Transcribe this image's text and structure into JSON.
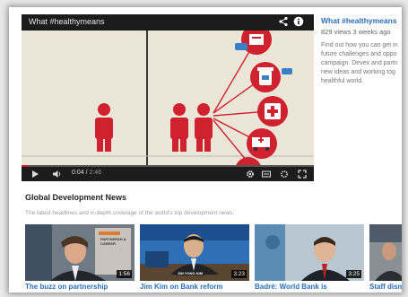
{
  "player": {
    "title": "What #healthymeans",
    "time_current": "0:04",
    "time_duration": "2:46",
    "progress": 0.024
  },
  "info": {
    "title": "What #healthymeans",
    "meta": "829 views  3 weeks ago",
    "desc_lines": [
      "Find out how you can get in",
      "future challenges and oppo",
      "campaign. Devex and partn",
      "new ideas and working tog",
      "healthful world."
    ]
  },
  "section": {
    "title": "Global Development News",
    "subtitle": "The latest headlines and in-depth coverage of the world's top development news."
  },
  "thumbs": [
    {
      "caption": "The buzz on partnership",
      "duration": "1:56",
      "overlay": "PARTNERSH & CAREER"
    },
    {
      "caption": "Jim Kim on Bank reform",
      "duration": "3:23",
      "overlay": "JIM YONG KIM"
    },
    {
      "caption": "Badré: World Bank is",
      "duration": "3:25",
      "overlay": ""
    },
    {
      "caption": "Staff dism",
      "duration": "",
      "overlay": ""
    }
  ],
  "colors": {
    "accent_red": "#d0222e",
    "link_blue": "#2a6eb9",
    "video_bg": "#ebe6d8"
  },
  "icons": [
    "share-icon",
    "info-icon",
    "play-icon",
    "volume-icon",
    "captions-icon",
    "fullscreen-icon",
    "settings-icon"
  ]
}
